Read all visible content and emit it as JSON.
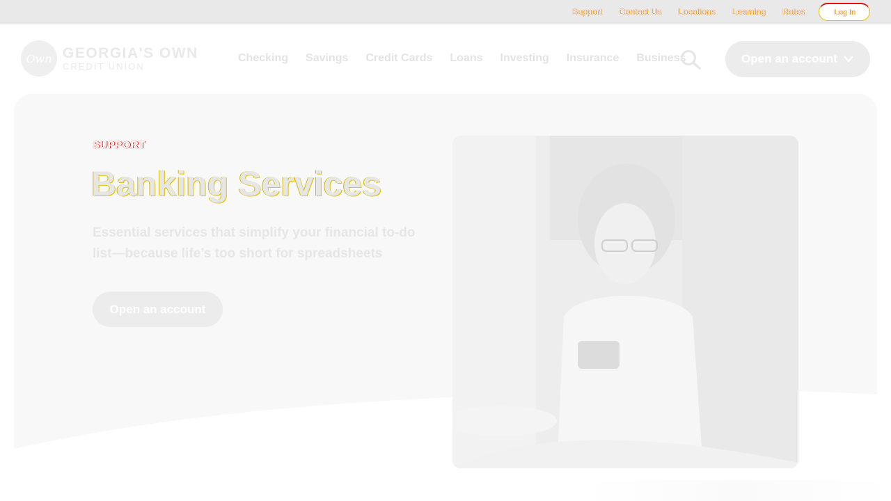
{
  "utility_nav": {
    "links": [
      "Support",
      "Contact Us",
      "Locations",
      "Learning",
      "Rates"
    ],
    "login_label": "Log In"
  },
  "header": {
    "logo": {
      "mark": "Own",
      "line1": "GEORGIA'S OWN",
      "line2": "CREDIT UNION"
    },
    "nav": [
      "Checking",
      "Savings",
      "Credit Cards",
      "Loans",
      "Investing",
      "Insurance",
      "Business"
    ],
    "search_icon": "search-icon",
    "cta_label": "Open an account",
    "cta_icon": "chevron-down-icon"
  },
  "hero": {
    "eyebrow": "SUPPORT",
    "title": "Banking Services",
    "description": "Essential services that simplify your financial to-do list—because life’s too short for spreadsheets",
    "cta_label": "Open an account"
  },
  "colors": {
    "topbar_bg": "#e9e9e9",
    "hero_bg": "#f8f8f8",
    "button_bg": "#ececec",
    "accent_red": "#e01010",
    "accent_yellow": "#e6c400"
  }
}
